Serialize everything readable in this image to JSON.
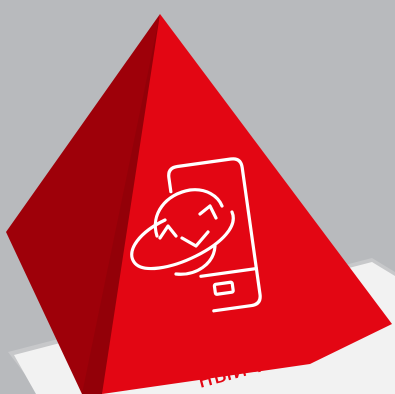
{
  "colors": {
    "background": "#b8babd",
    "pyramid_front": "#e30613",
    "pyramid_left": "#9e0009",
    "pyramid_left_dark": "#7e0007",
    "icon_stroke": "#ffffff",
    "card": "#f2f2f2",
    "card_shadow": "#c7c8ca",
    "caption_color": "#e30613"
  },
  "icon": {
    "name": "mobile-internet-icon",
    "parts": [
      "smartphone-icon",
      "globe-with-sync-arrows-icon"
    ]
  },
  "caption": {
    "text": "ный инте"
  }
}
